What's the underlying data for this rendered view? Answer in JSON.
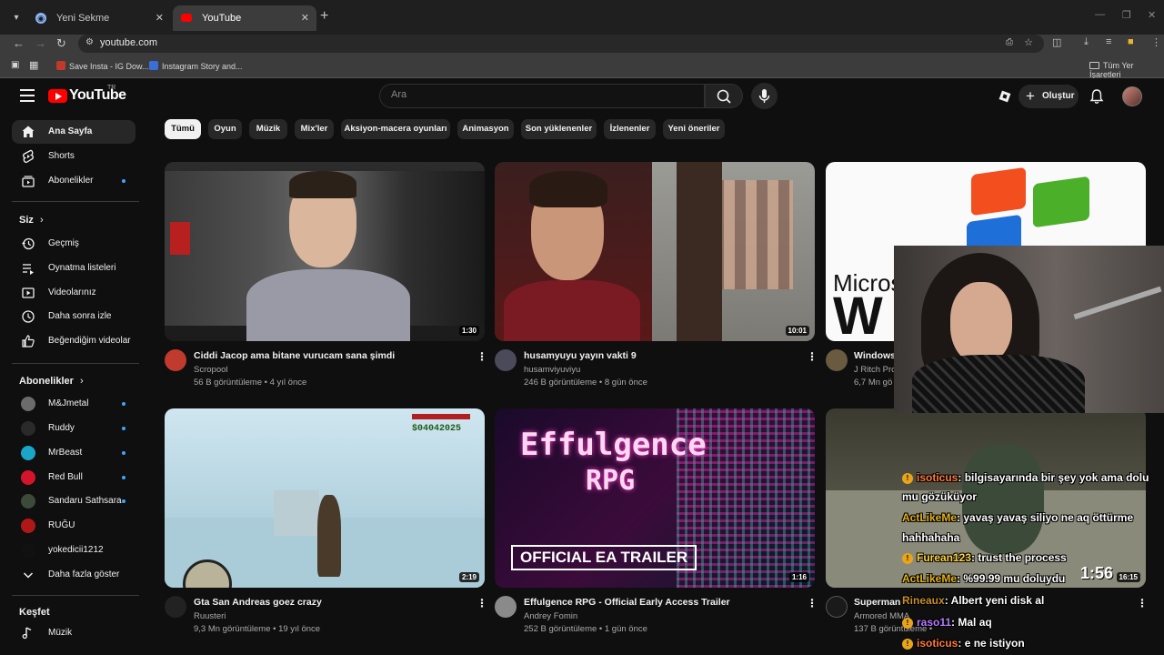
{
  "browser": {
    "tabs": [
      {
        "title": "Yeni Sekme",
        "active": false,
        "icon": "chrome-icon"
      },
      {
        "title": "YouTube",
        "active": true,
        "icon": "youtube-icon"
      }
    ],
    "url": "youtube.com",
    "bookmarks": [
      {
        "label": "Save Insta - IG Dow..."
      },
      {
        "label": "Instagram Story and..."
      }
    ],
    "all_bookmarks": "Tüm Yer İşaretleri"
  },
  "header": {
    "logo_text": "YouTube",
    "logo_region": "TR",
    "search_placeholder": "Ara",
    "create_label": "Oluştur"
  },
  "sidebar": {
    "main": [
      {
        "label": "Ana Sayfa",
        "icon": "home-icon",
        "active": true
      },
      {
        "label": "Shorts",
        "icon": "shorts-icon"
      },
      {
        "label": "Abonelikler",
        "icon": "subscriptions-icon",
        "dot": true
      }
    ],
    "you_heading": "Siz",
    "you": [
      {
        "label": "Geçmiş",
        "icon": "history-icon"
      },
      {
        "label": "Oynatma listeleri",
        "icon": "playlists-icon"
      },
      {
        "label": "Videolarınız",
        "icon": "your-videos-icon"
      },
      {
        "label": "Daha sonra izle",
        "icon": "watch-later-icon"
      },
      {
        "label": "Beğendiğim videolar",
        "icon": "liked-icon"
      }
    ],
    "subs_heading": "Abonelikler",
    "subs": [
      {
        "label": "M&Jmetal",
        "color": "#6b6b6b",
        "dot": true
      },
      {
        "label": "Ruddy",
        "color": "#2a2a2a",
        "dot": true
      },
      {
        "label": "MrBeast",
        "color": "#1aa6c8",
        "dot": true
      },
      {
        "label": "Red Bull",
        "color": "#d4142a",
        "dot": true
      },
      {
        "label": "Sandaru Sathsara",
        "color": "#3d4a3a",
        "dot": true
      },
      {
        "label": "RUĞU",
        "color": "#b01818",
        "dot": false
      },
      {
        "label": "yokedicii1212",
        "color": "#111111",
        "dot": false
      }
    ],
    "show_more": "Daha fazla göster",
    "explore_heading": "Keşfet",
    "explore": [
      {
        "label": "Müzik",
        "icon": "music-icon"
      }
    ]
  },
  "chips": [
    "Tümü",
    "Oyun",
    "Müzik",
    "Mix'ler",
    "Aksiyon-macera oyunları",
    "Animasyon",
    "Son yüklenenler",
    "İzlenenler",
    "Yeni öneriler"
  ],
  "videos": [
    {
      "title": "Ciddi Jacop ama bitane vurucam sana şimdi",
      "channel": "Scropool",
      "meta": "56 B görüntüleme • 4 yıl önce",
      "duration": "1:30"
    },
    {
      "title": "husamyuyu yayın vakti 9",
      "channel": "husamviyuviyu",
      "meta": "246 B görüntüleme • 8 gün önce",
      "duration": "10:01"
    },
    {
      "title": "Windows",
      "channel": "J Ritch Pro",
      "meta": "6,7 Mn gö",
      "duration": ""
    },
    {
      "title": "Gta San Andreas goez crazy",
      "channel": "Ruusteri",
      "meta": "9,3 Mn görüntüleme • 19 yıl önce",
      "duration": "2:19"
    },
    {
      "title": "Effulgence RPG - Official Early Access Trailer",
      "channel": "Andrey Fomin",
      "meta": "252 B görüntüleme • 1 gün önce",
      "duration": "1:16"
    },
    {
      "title": "Superman F",
      "channel": "Armored MMA",
      "meta": "137 B görüntüleme • ",
      "duration": "16:15"
    }
  ],
  "thumb_text": {
    "effulgence_top": "Effulgence",
    "effulgence_bottom": "RPG",
    "effulgence_banner": "OFFICIAL EA TRAILER",
    "windows_word": "Micros",
    "windows_big": "W",
    "gta_money": "$04042025"
  },
  "chat": [
    {
      "user": "isoticus",
      "user_color": "#ff7a3c",
      "text": ": bilgisayarında bir şey yok ama dolu"
    },
    {
      "user": "",
      "user_color": "#ffffff",
      "text": "mu gözüküyor"
    },
    {
      "user": "ActLikeMe",
      "user_color": "#e3b21a",
      "text": ": yavaş yavaş siliyo ne aq öttürme"
    },
    {
      "user": "",
      "user_color": "#ffffff",
      "text": "hahhahaha"
    },
    {
      "user": "Furean123",
      "user_color": "#ffd23c",
      "text": ": trust the process"
    },
    {
      "user": "ActLikeMe",
      "user_color": "#e3b21a",
      "text": ": %99.99 mu doluydu"
    },
    {
      "user": "Rineaux",
      "user_color": "#c78d2a",
      "text": ": Albert yeni disk al"
    },
    {
      "user": "raso11",
      "user_color": "#b57aff",
      "text": ": Mal aq"
    },
    {
      "user": "isoticus",
      "user_color": "#ff7a3c",
      "text": ": e ne istiyon"
    }
  ],
  "timer": "1:56"
}
